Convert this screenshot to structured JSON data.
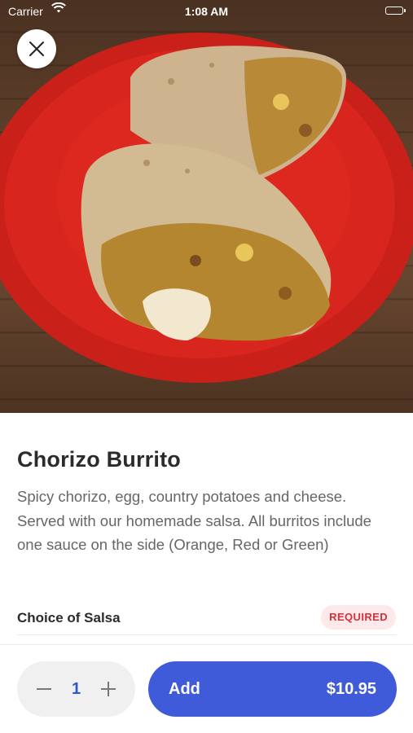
{
  "statusbar": {
    "carrier": "Carrier",
    "time": "1:08 AM"
  },
  "hero": {
    "alt": "Chorizo burrito on a red plate"
  },
  "item": {
    "title": "Chorizo Burrito",
    "description": "Spicy chorizo, egg, country potatoes and cheese. Served with our homemade salsa. All burritos include one sauce on the side (Orange, Red or Green)"
  },
  "options": {
    "group_label": "Choice of Salsa",
    "badge": "REQUIRED"
  },
  "order": {
    "quantity": "1",
    "add_label": "Add",
    "price": "$10.95"
  },
  "icons": {
    "close": "close-icon",
    "minus": "minus-icon",
    "plus": "plus-icon",
    "wifi": "wifi-icon",
    "battery": "battery-icon"
  },
  "colors": {
    "accent": "#3f5bd9",
    "required_text": "#d6303c",
    "required_bg": "#fde8ea"
  }
}
